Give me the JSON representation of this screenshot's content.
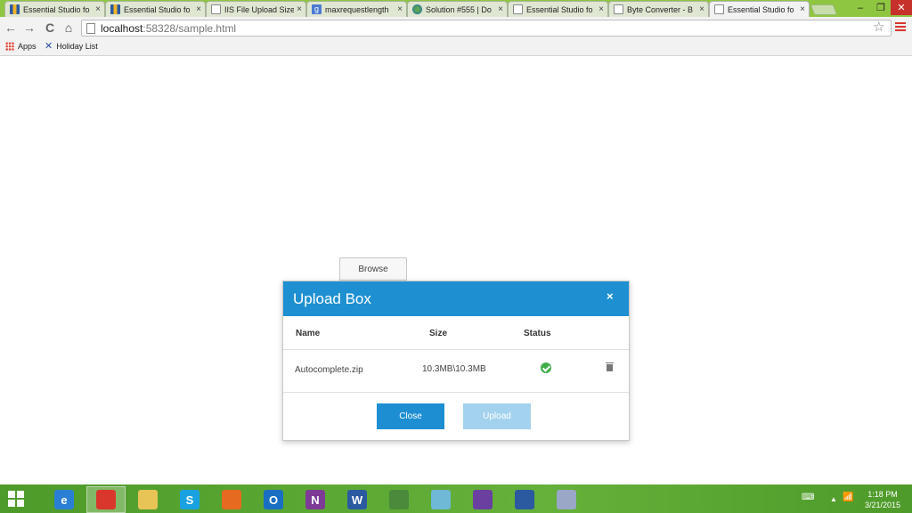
{
  "browser": {
    "tabs": [
      {
        "title": "Essential Studio fo",
        "icon": "grid-icon",
        "close": "×"
      },
      {
        "title": "Essential Studio fo",
        "icon": "grid-icon",
        "close": "×"
      },
      {
        "title": "IIS File Upload Size",
        "icon": "page-icon",
        "close": "×"
      },
      {
        "title": "maxrequestlength",
        "icon": "google-icon",
        "close": "×"
      },
      {
        "title": "Solution #555 | Do",
        "icon": "solution-icon",
        "close": "×"
      },
      {
        "title": "Essential Studio fo",
        "icon": "page-icon",
        "close": "×"
      },
      {
        "title": "Byte Converter - B",
        "icon": "page-icon",
        "close": "×"
      },
      {
        "title": "Essential Studio fo",
        "icon": "page-icon",
        "close": "×"
      }
    ],
    "active_tab_index": 7,
    "window_controls": {
      "minimize": "–",
      "maximize": "❐",
      "close": "✕"
    },
    "nav": {
      "back": "←",
      "forward": "→",
      "reload": "C",
      "home": "⌂"
    },
    "url_host": "localhost",
    "url_rest": ":58328/sample.html",
    "bookmark_star": "☆",
    "bookmarks": [
      {
        "label": "Apps",
        "icon": "apps-icon"
      },
      {
        "label": "Holiday List",
        "icon": "holiday-list-icon"
      }
    ]
  },
  "page": {
    "browse_label": "Browse",
    "dialog": {
      "title": "Upload Box",
      "close_glyph": "×",
      "columns": {
        "name": "Name",
        "size": "Size",
        "status": "Status"
      },
      "files": [
        {
          "name": "Autocomplete.zip",
          "size": "10.3MB\\10.3MB",
          "status_icon": "check-circle-icon",
          "action_icon": "trash-icon"
        }
      ],
      "buttons": {
        "close": "Close",
        "upload": "Upload"
      }
    }
  },
  "taskbar": {
    "items": [
      {
        "name": "ie-taskbar-icon",
        "glyph": "e",
        "color": "#2a7fd4",
        "active": false
      },
      {
        "name": "chrome-taskbar-icon",
        "glyph": "",
        "color": "#d9372b",
        "active": true
      },
      {
        "name": "explorer-taskbar-icon",
        "glyph": "",
        "color": "#e8c457",
        "active": false
      },
      {
        "name": "skype-taskbar-icon",
        "glyph": "S",
        "color": "#1aa1e1",
        "active": false
      },
      {
        "name": "firefox-taskbar-icon",
        "glyph": "",
        "color": "#e66a1f",
        "active": false
      },
      {
        "name": "outlook-taskbar-icon",
        "glyph": "O",
        "color": "#1a6fc2",
        "active": false
      },
      {
        "name": "onenote-taskbar-icon",
        "glyph": "N",
        "color": "#7d3b96",
        "active": false
      },
      {
        "name": "word-taskbar-icon",
        "glyph": "W",
        "color": "#2b5aa0",
        "active": false
      },
      {
        "name": "project-taskbar-icon",
        "glyph": "",
        "color": "#4a8a3a",
        "active": false
      },
      {
        "name": "app-taskbar-icon",
        "glyph": "",
        "color": "#6fb8d6",
        "active": false
      },
      {
        "name": "visual-studio-taskbar-icon",
        "glyph": "",
        "color": "#6a3fa0",
        "active": false
      },
      {
        "name": "syncfusion-taskbar-icon",
        "glyph": "",
        "color": "#2b5aa0",
        "active": false
      },
      {
        "name": "tool-taskbar-icon",
        "glyph": "",
        "color": "#9aa7c6",
        "active": false
      }
    ],
    "tray": {
      "keyboard": "⌨",
      "arrow": "▲",
      "network": "📶"
    },
    "clock": {
      "time": "1:18 PM",
      "date": "3/21/2015"
    }
  },
  "colors": {
    "accent": "#1e90d2",
    "titlebar": "#8fc641",
    "taskbar": "#5ea834",
    "success": "#3fae49"
  }
}
